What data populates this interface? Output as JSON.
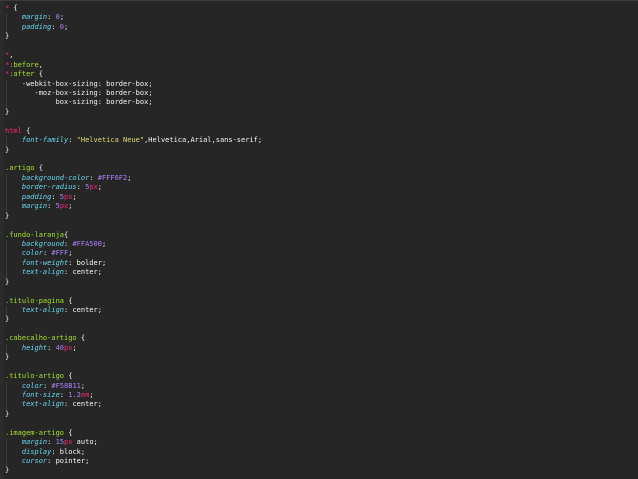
{
  "editor": {
    "theme": "monokai",
    "colors": {
      "background": "#262626",
      "selector": "#a6e22e",
      "asterisk": "#f92672",
      "property": "#66d9ef",
      "number": "#ae81ff",
      "unit": "#f92672",
      "string": "#e6db74"
    },
    "lines": [
      [
        {
          "t": "*",
          "c": "ast"
        },
        {
          "t": " {",
          "c": "punc"
        }
      ],
      [
        {
          "t": "    margin",
          "c": "prop"
        },
        {
          "t": ": ",
          "c": "punc"
        },
        {
          "t": "0",
          "c": "num"
        },
        {
          "t": ";",
          "c": "punc"
        }
      ],
      [
        {
          "t": "    padding",
          "c": "prop"
        },
        {
          "t": ": ",
          "c": "punc"
        },
        {
          "t": "0",
          "c": "num"
        },
        {
          "t": ";",
          "c": "punc"
        }
      ],
      [
        {
          "t": "}",
          "c": "punc"
        }
      ],
      [],
      [
        {
          "t": "*",
          "c": "ast"
        },
        {
          "t": ",",
          "c": "punc"
        }
      ],
      [
        {
          "t": "*",
          "c": "ast"
        },
        {
          "t": ":before",
          "c": "pseudo"
        },
        {
          "t": ",",
          "c": "punc"
        }
      ],
      [
        {
          "t": "*",
          "c": "ast"
        },
        {
          "t": ":after",
          "c": "pseudo"
        },
        {
          "t": " {",
          "c": "punc"
        }
      ],
      [
        {
          "t": "    -webkit-box-sizing",
          "c": "propn"
        },
        {
          "t": ": ",
          "c": "punc"
        },
        {
          "t": "border-box",
          "c": "val"
        },
        {
          "t": ";",
          "c": "punc"
        }
      ],
      [
        {
          "t": "       -moz-box-sizing",
          "c": "propn"
        },
        {
          "t": ": ",
          "c": "punc"
        },
        {
          "t": "border-box",
          "c": "val"
        },
        {
          "t": ";",
          "c": "punc"
        }
      ],
      [
        {
          "t": "            box-sizing",
          "c": "propn"
        },
        {
          "t": ": ",
          "c": "punc"
        },
        {
          "t": "border-box",
          "c": "val"
        },
        {
          "t": ";",
          "c": "punc"
        }
      ],
      [
        {
          "t": "}",
          "c": "punc"
        }
      ],
      [],
      [
        {
          "t": "html",
          "c": "ast"
        },
        {
          "t": " {",
          "c": "punc"
        }
      ],
      [
        {
          "t": "    font-family",
          "c": "prop"
        },
        {
          "t": ": ",
          "c": "punc"
        },
        {
          "t": "\"Helvetica Neue\"",
          "c": "str"
        },
        {
          "t": ",Helvetica,Arial,sans-serif;",
          "c": "val"
        }
      ],
      [
        {
          "t": "}",
          "c": "punc"
        }
      ],
      [],
      [
        {
          "t": ".artigo",
          "c": "sel"
        },
        {
          "t": " {",
          "c": "punc"
        }
      ],
      [
        {
          "t": "    background-color",
          "c": "prop"
        },
        {
          "t": ": ",
          "c": "punc"
        },
        {
          "t": "#FFF6F2",
          "c": "num"
        },
        {
          "t": ";",
          "c": "punc"
        }
      ],
      [
        {
          "t": "    border-radius",
          "c": "prop"
        },
        {
          "t": ": ",
          "c": "punc"
        },
        {
          "t": "5",
          "c": "num"
        },
        {
          "t": "px",
          "c": "unit"
        },
        {
          "t": ";",
          "c": "punc"
        }
      ],
      [
        {
          "t": "    padding",
          "c": "prop"
        },
        {
          "t": ": ",
          "c": "punc"
        },
        {
          "t": "5",
          "c": "num"
        },
        {
          "t": "px",
          "c": "unit"
        },
        {
          "t": ";",
          "c": "punc"
        }
      ],
      [
        {
          "t": "    margin",
          "c": "prop"
        },
        {
          "t": ": ",
          "c": "punc"
        },
        {
          "t": "5",
          "c": "num"
        },
        {
          "t": "px",
          "c": "unit"
        },
        {
          "t": ";",
          "c": "punc"
        }
      ],
      [
        {
          "t": "}",
          "c": "punc"
        }
      ],
      [],
      [
        {
          "t": ".fundo-laranja",
          "c": "sel"
        },
        {
          "t": "{",
          "c": "punc"
        }
      ],
      [
        {
          "t": "    background",
          "c": "prop"
        },
        {
          "t": ": ",
          "c": "punc"
        },
        {
          "t": "#FFA500",
          "c": "num"
        },
        {
          "t": ";",
          "c": "punc"
        }
      ],
      [
        {
          "t": "    color",
          "c": "prop"
        },
        {
          "t": ": ",
          "c": "punc"
        },
        {
          "t": "#FFF",
          "c": "num"
        },
        {
          "t": ";",
          "c": "punc"
        }
      ],
      [
        {
          "t": "    font-weight",
          "c": "prop"
        },
        {
          "t": ": ",
          "c": "punc"
        },
        {
          "t": "bolder",
          "c": "val"
        },
        {
          "t": ";",
          "c": "punc"
        }
      ],
      [
        {
          "t": "    text-align",
          "c": "prop"
        },
        {
          "t": ": ",
          "c": "punc"
        },
        {
          "t": "center",
          "c": "val"
        },
        {
          "t": ";",
          "c": "punc"
        }
      ],
      [
        {
          "t": "}",
          "c": "punc"
        }
      ],
      [],
      [
        {
          "t": ".titulo-pagina",
          "c": "sel"
        },
        {
          "t": " {",
          "c": "punc"
        }
      ],
      [
        {
          "t": "    text-align",
          "c": "prop"
        },
        {
          "t": ": ",
          "c": "punc"
        },
        {
          "t": "center",
          "c": "val"
        },
        {
          "t": ";",
          "c": "punc"
        }
      ],
      [
        {
          "t": "}",
          "c": "punc"
        }
      ],
      [],
      [
        {
          "t": ".cabecalho-artigo",
          "c": "sel"
        },
        {
          "t": " {",
          "c": "punc"
        }
      ],
      [
        {
          "t": "    height",
          "c": "prop"
        },
        {
          "t": ": ",
          "c": "punc"
        },
        {
          "t": "40",
          "c": "num"
        },
        {
          "t": "px",
          "c": "unit"
        },
        {
          "t": ";",
          "c": "punc"
        }
      ],
      [
        {
          "t": "}",
          "c": "punc"
        }
      ],
      [],
      [
        {
          "t": ".titulo-artigo",
          "c": "sel"
        },
        {
          "t": " {",
          "c": "punc"
        }
      ],
      [
        {
          "t": "    color",
          "c": "prop"
        },
        {
          "t": ": ",
          "c": "punc"
        },
        {
          "t": "#F58B11",
          "c": "num"
        },
        {
          "t": ";",
          "c": "punc"
        }
      ],
      [
        {
          "t": "    font-size",
          "c": "prop"
        },
        {
          "t": ": ",
          "c": "punc"
        },
        {
          "t": "1.2",
          "c": "num"
        },
        {
          "t": "em",
          "c": "unit"
        },
        {
          "t": ";",
          "c": "punc"
        }
      ],
      [
        {
          "t": "    text-align",
          "c": "prop"
        },
        {
          "t": ": ",
          "c": "punc"
        },
        {
          "t": "center",
          "c": "val"
        },
        {
          "t": ";",
          "c": "punc"
        }
      ],
      [
        {
          "t": "}",
          "c": "punc"
        }
      ],
      [],
      [
        {
          "t": ".imagem-artigo",
          "c": "sel"
        },
        {
          "t": " {",
          "c": "punc"
        }
      ],
      [
        {
          "t": "    margin",
          "c": "prop"
        },
        {
          "t": ": ",
          "c": "punc"
        },
        {
          "t": "15",
          "c": "num"
        },
        {
          "t": "px",
          "c": "unit"
        },
        {
          "t": " auto;",
          "c": "val"
        }
      ],
      [
        {
          "t": "    display",
          "c": "prop"
        },
        {
          "t": ": ",
          "c": "punc"
        },
        {
          "t": "block",
          "c": "val"
        },
        {
          "t": ";",
          "c": "punc"
        }
      ],
      [
        {
          "t": "    cursor",
          "c": "prop"
        },
        {
          "t": ": ",
          "c": "punc"
        },
        {
          "t": "pointer",
          "c": "val"
        },
        {
          "t": ";",
          "c": "punc"
        }
      ],
      [
        {
          "t": "}",
          "c": "punc"
        }
      ]
    ]
  }
}
